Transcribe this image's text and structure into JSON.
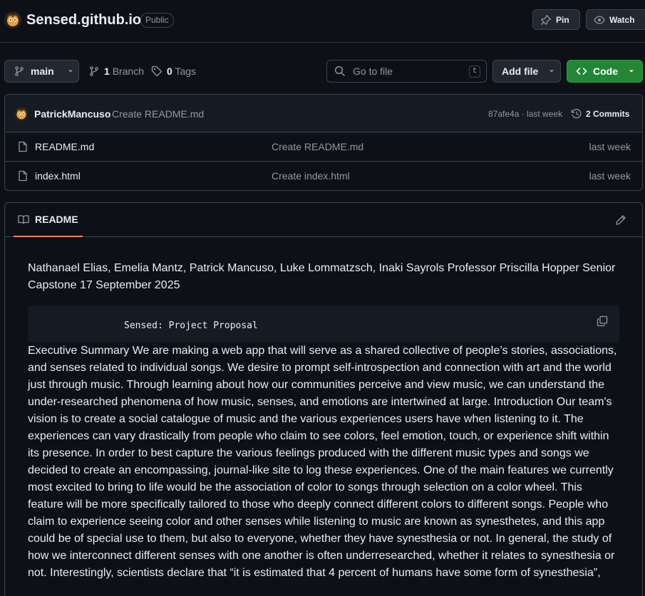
{
  "header": {
    "repo_name": "Sensed.github.io",
    "visibility": "Public",
    "pin_label": "Pin",
    "watch_label": "Watch"
  },
  "toolbar": {
    "branch": "main",
    "branches_count": "1",
    "branches_label": "Branch",
    "tags_count": "0",
    "tags_label": "Tags",
    "search_placeholder": "Go to file",
    "search_shortcut": "t",
    "add_file_label": "Add file",
    "code_label": "Code"
  },
  "latest_commit": {
    "author": "PatrickMancuso",
    "message": "Create README.md",
    "meta": "87afe4a · last week",
    "commits_label": "2 Commits"
  },
  "files": [
    {
      "name": "README.md",
      "commit": "Create README.md",
      "age": "last week"
    },
    {
      "name": "index.html",
      "commit": "Create index.html",
      "age": "last week"
    }
  ],
  "readme": {
    "tab_label": "README",
    "intro": "Nathanael Elias, Emelia Mantz, Patrick Mancuso, Luke Lommatzsch, Inaki Sayrols Professor Priscilla Hopper Senior Capstone 17 September 2025",
    "code_text": "Sensed: Project Proposal",
    "summary": "Executive Summary We are making a web app that will serve as a shared collective of people’s stories, associations, and senses related to individual songs. We desire to prompt self-introspection and connection with art and the world just through music. Through learning about how our communities perceive and view music, we can understand the under-researched phenomena of how music, senses, and emotions are intertwined at large. Introduction Our team's vision is to create a social catalogue of music and the various experiences users have when listening to it. The experiences can vary drastically from people who claim to see colors, feel emotion, touch, or experience shift within its presence. In order to best capture the various feelings produced with the different music types and songs we decided to create an encompassing, journal-like site to log these experiences. One of the main features we currently most excited to bring to life would be the association of color to songs through selection on a color wheel. This feature will be more specifically tailored to those who deeply connect different colors to different songs. People who claim to experience seeing color and other senses while listening to music are known as synesthetes, and this app could be of special use to them, but also to everyone, whether they have synesthesia or not. In general, the study of how we interconnect different senses with one another is often underresearched, whether it relates to synesthesia or not. Interestingly, scientists declare that “it is estimated that 4 percent of humans have some form of synesthesia”,"
  },
  "colors": {
    "background": "#0d1117",
    "border": "#3d444d",
    "muted_text": "#9198a1",
    "code_button": "#238636",
    "active_tab_underline": "#f78166"
  }
}
